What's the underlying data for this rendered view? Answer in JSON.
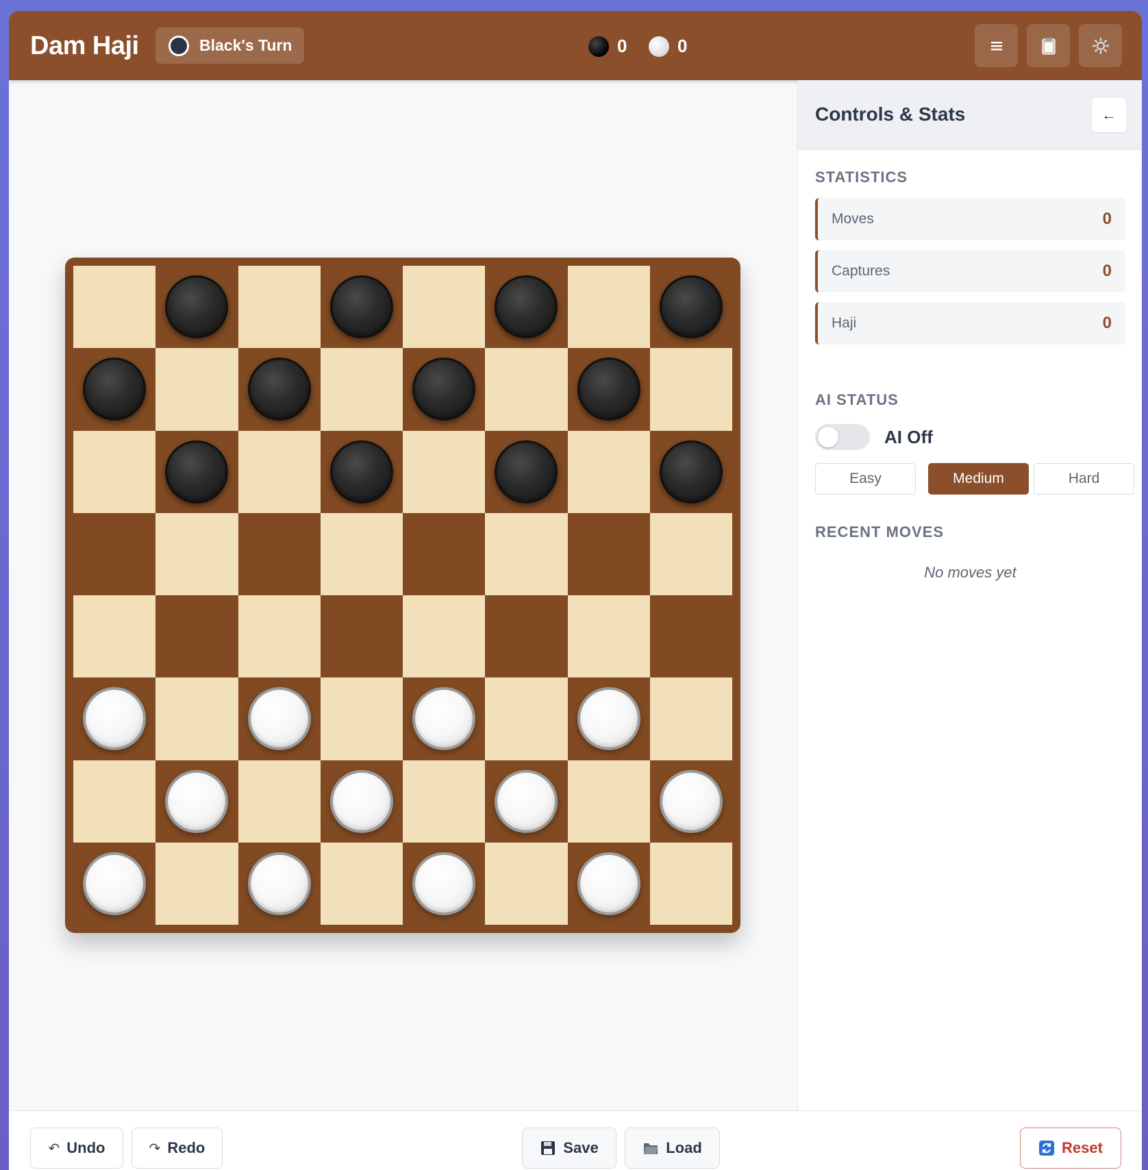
{
  "app": {
    "title": "Dam Haji",
    "turn_label": "Black's Turn",
    "scores": {
      "black": "0",
      "white": "0"
    },
    "icons": {
      "menu": "hamburger-menu-icon",
      "clipboard": "clipboard-icon",
      "settings": "gear-icon"
    }
  },
  "board": {
    "size": 8,
    "rows": [
      ". b . b . b . b",
      "b . b . b . b .",
      ". b . b . b . b",
      ". . . . . . . .",
      ". . . . . . . .",
      "w . w . w . w .",
      ". w . w . w . w",
      "w . w . w . w ."
    ],
    "colors": {
      "light": "#f1e0b9",
      "dark": "#814a22",
      "frame": "#814a22"
    }
  },
  "sidebar": {
    "title": "Controls & Stats",
    "collapse_icon": "←",
    "statistics": {
      "heading": "STATISTICS",
      "items": [
        {
          "label": "Moves",
          "value": "0"
        },
        {
          "label": "Captures",
          "value": "0"
        },
        {
          "label": "Haji",
          "value": "0"
        }
      ]
    },
    "ai": {
      "heading": "AI STATUS",
      "toggle_label": "AI Off",
      "enabled": false,
      "difficulties": [
        "Easy",
        "Medium",
        "Hard"
      ],
      "selected": "Medium"
    },
    "recent_moves": {
      "heading": "RECENT MOVES",
      "empty_text": "No moves yet"
    }
  },
  "footer": {
    "undo": "Undo",
    "redo": "Redo",
    "save": "Save",
    "load": "Load",
    "reset": "Reset"
  },
  "theme": {
    "accent": "#8b4f2c",
    "reset": "#c0392b"
  }
}
